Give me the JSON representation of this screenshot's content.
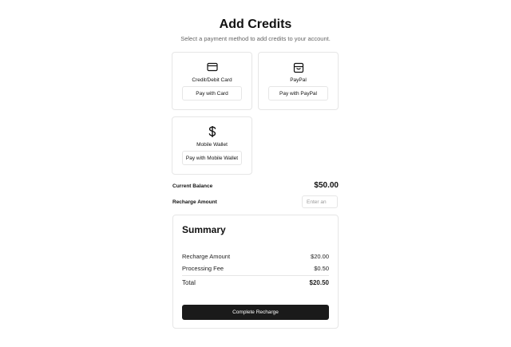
{
  "header": {
    "title": "Add Credits",
    "subtitle": "Select a payment method to add credits to your account."
  },
  "payment_methods": [
    {
      "label": "Credit/Debit Card",
      "button": "Pay with Card",
      "icon": "credit-card-icon"
    },
    {
      "label": "PayPal",
      "button": "Pay with PayPal",
      "icon": "wallet-icon"
    },
    {
      "label": "Mobile Wallet",
      "button": "Pay with Mobile Wallet",
      "icon": "dollar-icon"
    }
  ],
  "balance": {
    "label": "Current Balance",
    "value": "$50.00"
  },
  "recharge": {
    "label": "Recharge Amount",
    "placeholder": "Enter an"
  },
  "summary": {
    "title": "Summary",
    "rows": [
      {
        "label": "Recharge Amount",
        "value": "$20.00"
      },
      {
        "label": "Processing Fee",
        "value": "$0.50"
      }
    ],
    "total": {
      "label": "Total",
      "value": "$20.50"
    },
    "button": "Complete Recharge"
  },
  "colors": {
    "primary_button": "#1a1a1a",
    "border": "#e6e6e6",
    "muted_text": "#666666"
  }
}
